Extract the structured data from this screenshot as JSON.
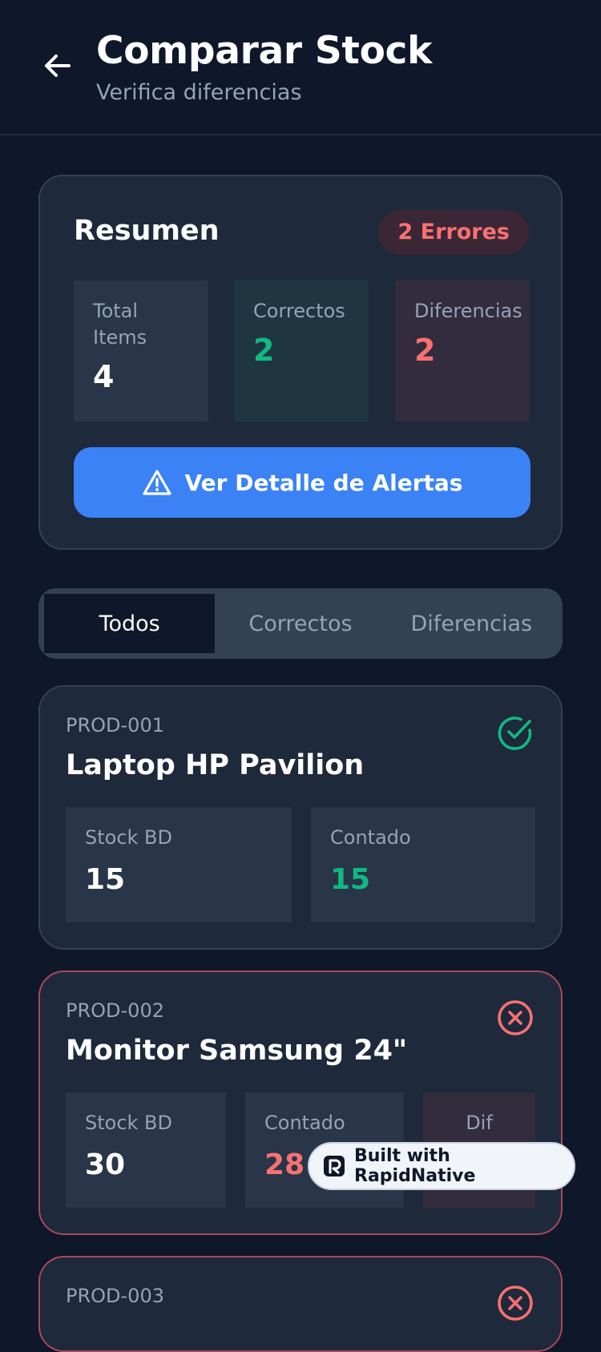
{
  "header": {
    "title": "Comparar Stock",
    "subtitle": "Verifica diferencias"
  },
  "summary": {
    "title": "Resumen",
    "error_badge": "2 Errores",
    "stats": [
      {
        "label": "Total Items",
        "value": "4"
      },
      {
        "label": "Correctos",
        "value": "2"
      },
      {
        "label": "Diferencias",
        "value": "2"
      }
    ],
    "alerts_button": "Ver Detalle de Alertas"
  },
  "tabs": [
    {
      "label": "Todos",
      "active": true
    },
    {
      "label": "Correctos",
      "active": false
    },
    {
      "label": "Diferencias",
      "active": false
    }
  ],
  "products": [
    {
      "code": "PROD-001",
      "name": "Laptop HP Pavilion",
      "status": "ok",
      "stock_label": "Stock BD",
      "stock": "15",
      "counted_label": "Contado",
      "counted": "15"
    },
    {
      "code": "PROD-002",
      "name": "Monitor Samsung 24\"",
      "status": "error",
      "stock_label": "Stock BD",
      "stock": "30",
      "counted_label": "Contado",
      "counted": "28",
      "diff_label": "Dif"
    },
    {
      "code": "PROD-003",
      "status": "error"
    }
  ],
  "badge": {
    "label": "Built with RapidNative"
  },
  "colors": {
    "background": "#0f172a",
    "card": "#1e293b",
    "accent": "#3b82f6",
    "success": "#10b981",
    "danger": "#f87171"
  }
}
